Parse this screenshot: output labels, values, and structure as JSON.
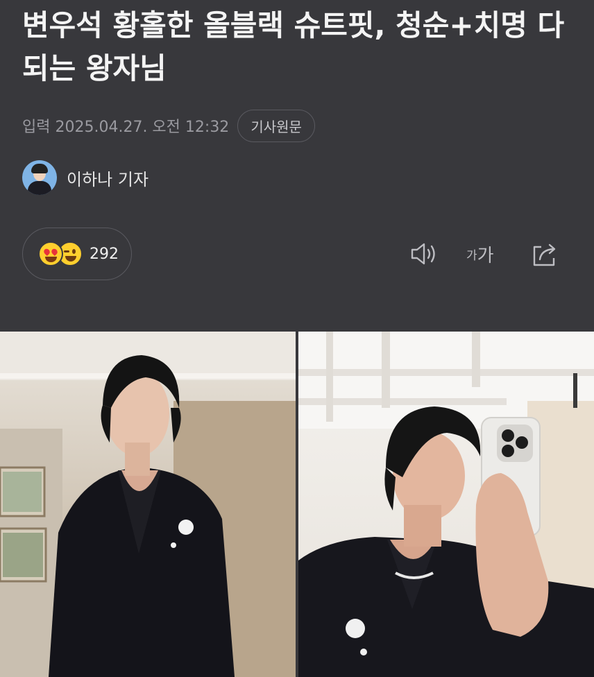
{
  "article": {
    "headline": "변우석 황홀한 올블랙 슈트핏, 청순+치명 다 되는 왕자님",
    "input_label": "입력",
    "datetime": "2025.04.27. 오전 12:32",
    "original_button": "기사원문",
    "reporter": "이하나 기자"
  },
  "reaction": {
    "count": "292",
    "icons": [
      "heart-eyes-emoji-icon",
      "grinning-wink-emoji-icon"
    ]
  },
  "tools": {
    "speaker_icon": "speaker-icon",
    "font_size_small": "가",
    "font_size_large": "가",
    "share_icon": "share-icon"
  },
  "photos": [
    {
      "description_icon": "photo-left"
    },
    {
      "description_icon": "photo-right"
    }
  ],
  "colors": {
    "background": "#38383c",
    "headline": "#f4f4f4",
    "meta": "#9a9aa0"
  }
}
